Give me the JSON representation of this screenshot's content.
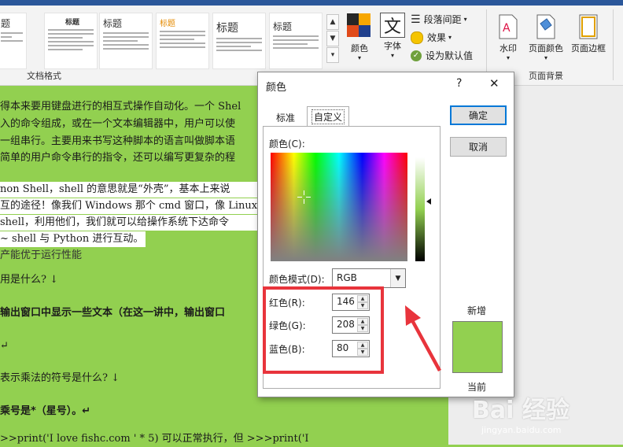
{
  "ribbon": {
    "group_doc_format": "文档格式",
    "group_page_bg": "页面背景",
    "styles": [
      "题",
      "标题",
      "标题",
      "标题",
      "标题",
      "标题"
    ],
    "colors_label": "颜色",
    "fonts_label": "字体",
    "fonts_icon_text": "文",
    "paragraph_spacing": "段落间距",
    "effects": "效果",
    "set_default": "设为默认值",
    "watermark": "水印",
    "page_color": "页面颜色",
    "page_border": "页面边框"
  },
  "document": {
    "lines": [
      "得本来要用键盘进行的相互式操作自动化。一个 Shel",
      "入的命令组成，或在一个文本编辑器中，用户可以使",
      "一组串行。主要用来书写这种脚本的语言叫做脚本语",
      "简单的用户命令串行的指令，还可以编写更复杂的程",
      "non Shell，shell 的意思就是“外壳”，基本上来说",
      "互的途径！像我们 Windows 那个 cmd 窗口，像 Linux",
      " shell，利用他们，我们就可以给操作系统下达命令",
      "~ shell 与 Python 进行互动。",
      "产能优于运行性能",
      "用是什么? ↓",
      "输出窗口中显示一些文本（在这一讲中，输出窗口",
      "↵",
      "表示乘法的符号是什么? ↓",
      "乘号是*（星号）。↵",
      ">>print('I love fishc.com ' * 5) 可以正常执行，但 >>>print('I"
    ]
  },
  "dialog": {
    "title": "颜色",
    "help": "?",
    "close": "✕",
    "tab_standard": "标准",
    "tab_custom": "自定义",
    "colors_label": "颜色(C):",
    "ok": "确定",
    "cancel": "取消",
    "color_model_label": "颜色模式(D):",
    "color_model_value": "RGB",
    "red_label": "红色(R):",
    "red_value": "146",
    "green_label": "绿色(G):",
    "green_value": "208",
    "blue_label": "蓝色(B):",
    "blue_value": "80",
    "new_label": "新增",
    "current_label": "当前",
    "new_color": "#92d050",
    "current_color": "#92d050"
  },
  "watermark": {
    "brand": "Bai 经验",
    "url": "jingyan.baidu.com"
  }
}
